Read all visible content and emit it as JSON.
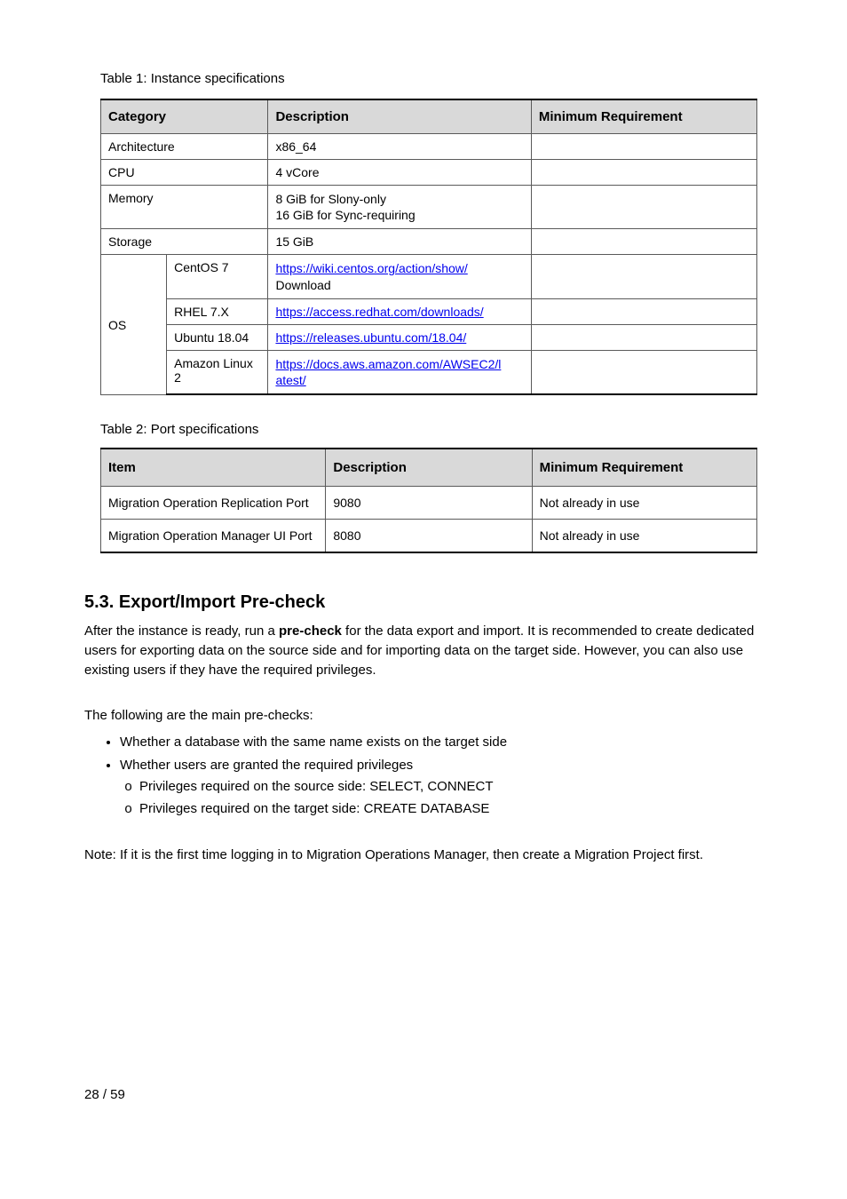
{
  "intro": "Table 1: Instance specifications",
  "table1": {
    "headers": [
      "Category",
      "",
      "Description",
      "Minimum Requirement"
    ],
    "rows": {
      "r1": [
        "Architecture",
        "",
        "x86_64",
        ""
      ],
      "r2": [
        "CPU",
        "",
        "4 vCore",
        ""
      ],
      "r3": {
        "cells": [
          "Memory",
          "",
          "",
          ""
        ],
        "desc_lines": [
          "8 GiB for Slony-only",
          "16 GiB for Sync-requiring"
        ]
      },
      "r4": [
        "Storage",
        "",
        "15 GiB",
        ""
      ],
      "os_group_label": "OS",
      "os_rows": [
        {
          "distro": "CentOS 7",
          "link_text": "https://wiki.centos.org/action/show/",
          "link_tail": "Download",
          "req": ""
        },
        {
          "distro": "RHEL 7.X",
          "link_text": "https://access.redhat.com/downloads/",
          "req": ""
        },
        {
          "distro": "Ubuntu 18.04",
          "link_text": "https://releases.ubuntu.com/18.04/",
          "req": ""
        },
        {
          "distro": "Amazon Linux 2",
          "link_text": "https://docs.aws.amazon.com/AWSEC2/l",
          "link_tail": "atest/",
          "req": ""
        }
      ]
    }
  },
  "table2_title": "Table 2: Port specifications",
  "table2": {
    "headers": [
      "Item",
      "Description",
      "Minimum Requirement"
    ],
    "rows": [
      {
        "item": "Migration Operation Replication Port",
        "desc": "9080",
        "req": "Not already in use"
      },
      {
        "item": "Migration Operation Manager UI Port",
        "desc": "8080",
        "req": "Not already in use"
      }
    ]
  },
  "section": {
    "heading": "5.3.  Export/Import Pre-check",
    "p1_a": "After the instance is ready, run a ",
    "p1_b": "pre-check",
    "p1_c": " for the data export and import. It is recommended to create dedicated users for exporting data on the source side and for importing data on the target side. However, you can also use existing users if they have the required privileges.",
    "p2": "The following are the main pre-checks:",
    "bullets": [
      "Whether a database with the same name exists on the target side",
      "Whether users are granted the required privileges"
    ],
    "sub_bullets": [
      "Privileges required on the source side: SELECT, CONNECT",
      "Privileges required on the target side: CREATE DATABASE"
    ],
    "note": "Note: If it is the first time logging in to Migration Operations Manager, then create a Migration Project first."
  },
  "footer": "28 / 59"
}
